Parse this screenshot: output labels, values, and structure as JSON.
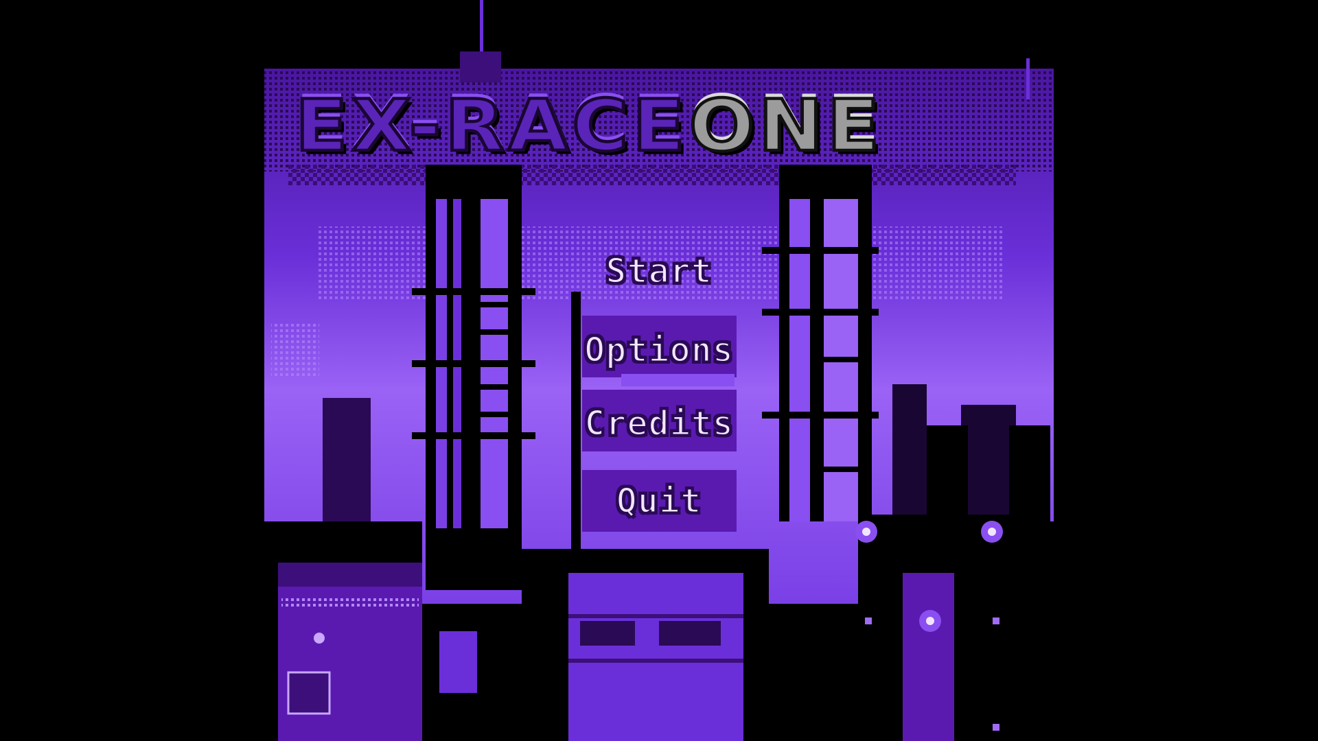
{
  "game": {
    "title_part1": "EX-RACE",
    "title_part2": "ONE"
  },
  "menu": {
    "items": [
      {
        "id": "start",
        "label": "Start"
      },
      {
        "id": "options",
        "label": "Options"
      },
      {
        "id": "credits",
        "label": "Credits"
      },
      {
        "id": "quit",
        "label": "Quit"
      }
    ]
  },
  "palette": {
    "background": "#000000",
    "sky_light": "#a06cf5",
    "sky_mid": "#8a4ff0",
    "sky_dark": "#6a2fd8",
    "building_dark": "#3c0f7a",
    "accent_deep": "#5a1ab0",
    "title_grey": "#9c9c9c",
    "lamp_glow": "#c9a8ff"
  }
}
